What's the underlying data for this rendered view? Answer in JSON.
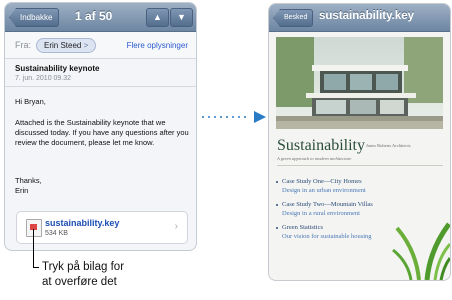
{
  "mail": {
    "back_label": "Indbakke",
    "counter": "1 af 50",
    "up_icon": "up-arrow-icon",
    "down_icon": "down-arrow-icon",
    "from_label": "Fra:",
    "sender": "Erin Steed",
    "details_link": "Flere oplysninger",
    "subject": "Sustainability keynote",
    "date": "7. jun. 2010 09.32",
    "body_lines": [
      "Hi Bryan,",
      "Attached is the Sustainability keynote that we discussed today. If you have any questions after you review the document, please let me know.",
      "Thanks,",
      "Erin"
    ],
    "attachment": {
      "name": "sustainability.key",
      "size": "534 KB"
    }
  },
  "callout": {
    "line1": "Tryk på bilag for",
    "line2": "at overføre det"
  },
  "viewer": {
    "back_label": "Besked",
    "title": "sustainability.key",
    "doc_title": "Sustainability",
    "doc_byline": "Jones Roberts Architects",
    "doc_subtitle": "A green approach to modern architecture",
    "items": [
      {
        "title": "Case Study One—City Homes",
        "desc": "Design in an urban environment"
      },
      {
        "title": "Case Study Two—Mountain Villas",
        "desc": "Design in a rural environment"
      },
      {
        "title": "Green Statistics",
        "desc": "Our vision for sustainable housing"
      }
    ]
  },
  "colors": {
    "nav_bar": "#6d86a2",
    "link_blue": "#2b5bd0",
    "arrow_blue": "#2a7bc6",
    "doc_title_green": "#2b4d3c"
  }
}
